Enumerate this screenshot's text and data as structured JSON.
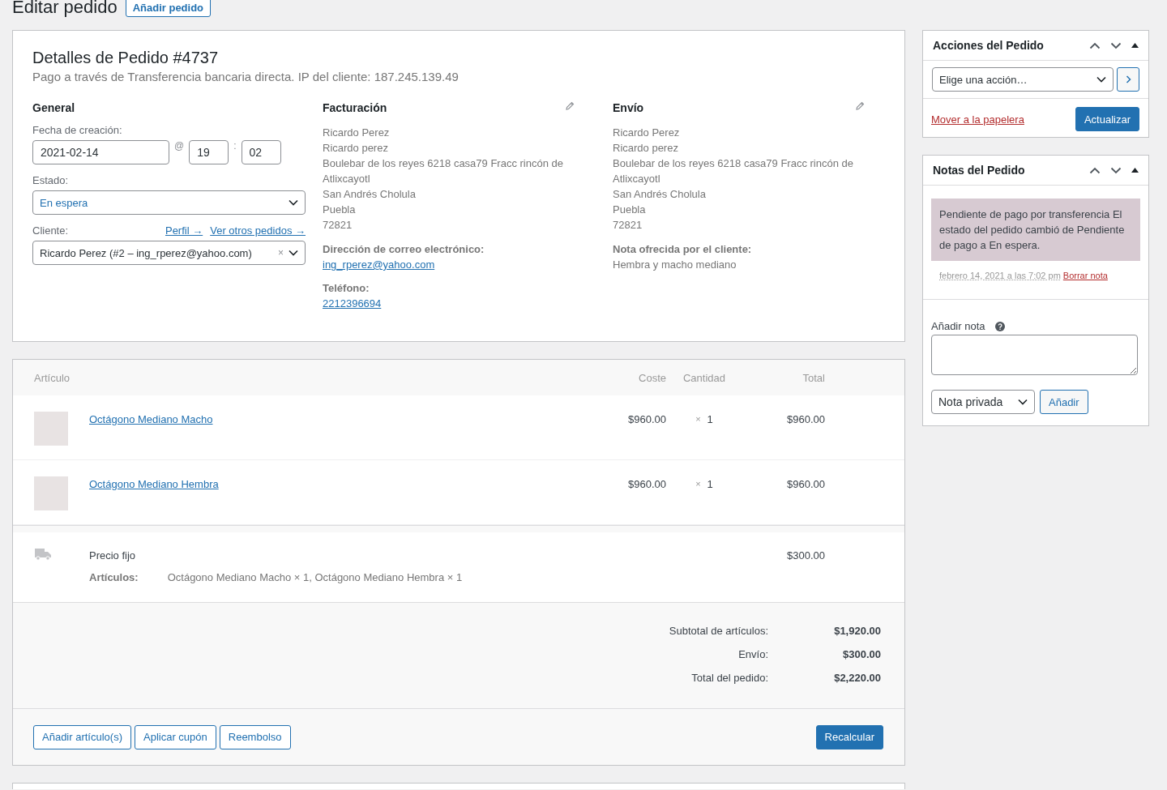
{
  "page": {
    "title": "Editar pedido",
    "add_button": "Añadir pedido"
  },
  "order": {
    "title": "Detalles de Pedido #4737",
    "subtitle": "Pago a través de Transferencia bancaria directa. IP del cliente: 187.245.139.49",
    "general": {
      "heading": "General",
      "date_label": "Fecha de creación:",
      "date": "2021-02-14",
      "at": "@",
      "hour": "19",
      "separator": ":",
      "minute": "02",
      "status_label": "Estado:",
      "status": "En espera",
      "customer_label": "Cliente:",
      "profile_link": "Perfil →",
      "orders_link": "Ver otros pedidos →",
      "customer": "Ricardo Perez (#2 – ing_rperez@yahoo.com)",
      "clear": "×"
    },
    "billing": {
      "heading": "Facturación",
      "address": [
        "Ricardo Perez",
        "Ricardo perez",
        "Boulebar de los reyes 6218 casa79 Fracc rincón de Atlixcayotl",
        "San Andrés Cholula",
        "Puebla",
        "72821"
      ],
      "fields": [
        {
          "label": "Dirección de correo electrónico:",
          "value": "ing_rperez@yahoo.com",
          "kind": "link"
        },
        {
          "label": "Teléfono:",
          "value": "2212396694",
          "kind": "link"
        }
      ]
    },
    "shipping": {
      "heading": "Envío",
      "address": [
        "Ricardo Perez",
        "Ricardo perez",
        "Boulebar de los reyes 6218 casa79 Fracc rincón de Atlixcayotl",
        "San Andrés Cholula",
        "Puebla",
        "72821"
      ],
      "fields": [
        {
          "label": "Nota ofrecida por el cliente:",
          "value": "Hembra y macho mediano",
          "kind": "text"
        }
      ]
    }
  },
  "items": {
    "columns": [
      "Artículo",
      "Coste",
      "Cantidad",
      "Total"
    ],
    "rows": [
      {
        "name": "Octágono Mediano Macho",
        "cost": "$960.00",
        "times": "×",
        "quantity": "1",
        "total": "$960.00"
      },
      {
        "name": "Octágono Mediano Hembra",
        "cost": "$960.00",
        "times": "×",
        "quantity": "1",
        "total": "$960.00"
      }
    ],
    "shipping": {
      "method": "Precio fijo",
      "total": "$300.00",
      "meta_label": "Artículos:",
      "meta_value": "Octágono Mediano Macho × 1, Octágono Mediano Hembra × 1"
    },
    "totals": [
      {
        "label": "Subtotal de artículos:",
        "value": "$1,920.00"
      },
      {
        "label": "Envío:",
        "value": "$300.00"
      },
      {
        "label": "Total del pedido:",
        "value": "$2,220.00"
      }
    ],
    "buttons": [
      "Añadir artículo(s)",
      "Aplicar cupón",
      "Reembolso"
    ],
    "recalculate": "Recalcular"
  },
  "sidebar": {
    "actions": {
      "title": "Acciones del Pedido",
      "select": "Elige una acción…",
      "trash": "Mover a la papelera",
      "update": "Actualizar"
    },
    "notes": {
      "title": "Notas del Pedido",
      "notes": [
        {
          "text": "Pendiente de pago por transferencia El estado del pedido cambió de Pendiente de pago a En espera.",
          "date": "febrero 14, 2021 a las 7:02 pm",
          "delete": "Borrar nota"
        }
      ],
      "add_label": "Añadir nota",
      "type": "Nota privada",
      "add": "Añadir"
    }
  }
}
